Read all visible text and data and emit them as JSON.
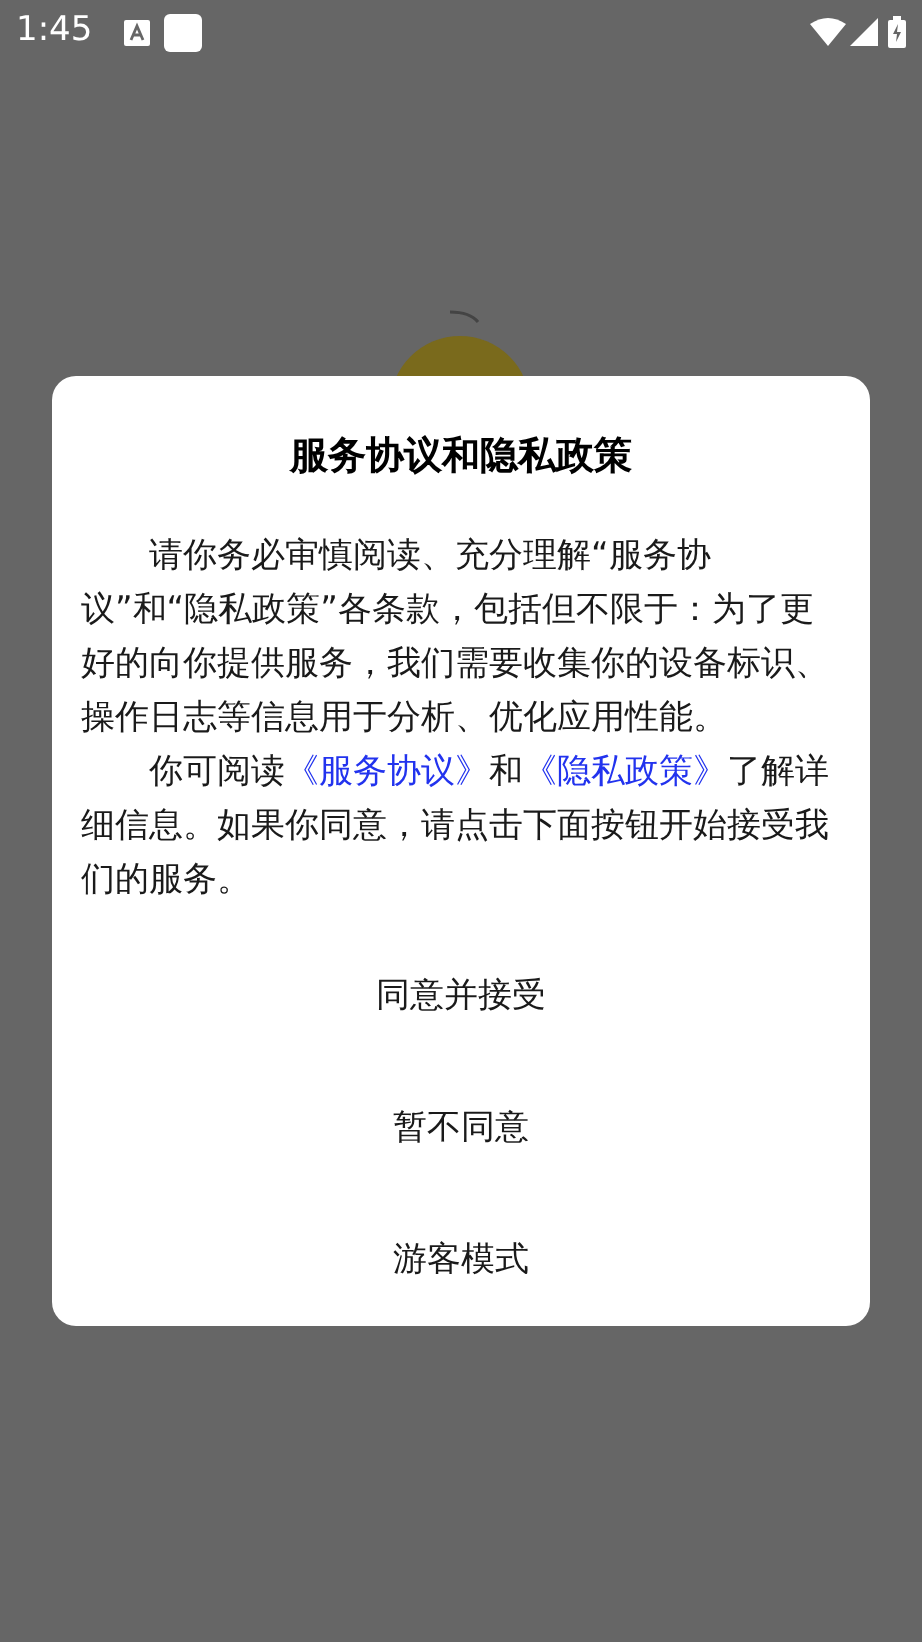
{
  "status_bar": {
    "time": "1:45"
  },
  "dialog": {
    "title": "服务协议和隐私政策",
    "paragraph_1": "请你务必审慎阅读、充分理解“服务协议”和“隐私政策”各条款，包括但不限于：为了更好的向你提供服务，我们需要收集你的设备标识、操作日志等信息用于分析、优化应用性能。",
    "paragraph_2": {
      "text_before": "你可阅读",
      "link_1": "《服务协议》",
      "text_middle": "和",
      "link_2": "《隐私政策》",
      "text_after": "了解详细信息。如果你同意，请点击下面按钮开始接受我们的服务。"
    },
    "buttons": [
      "同意并接受",
      "暂不同意",
      "游客模式"
    ]
  }
}
